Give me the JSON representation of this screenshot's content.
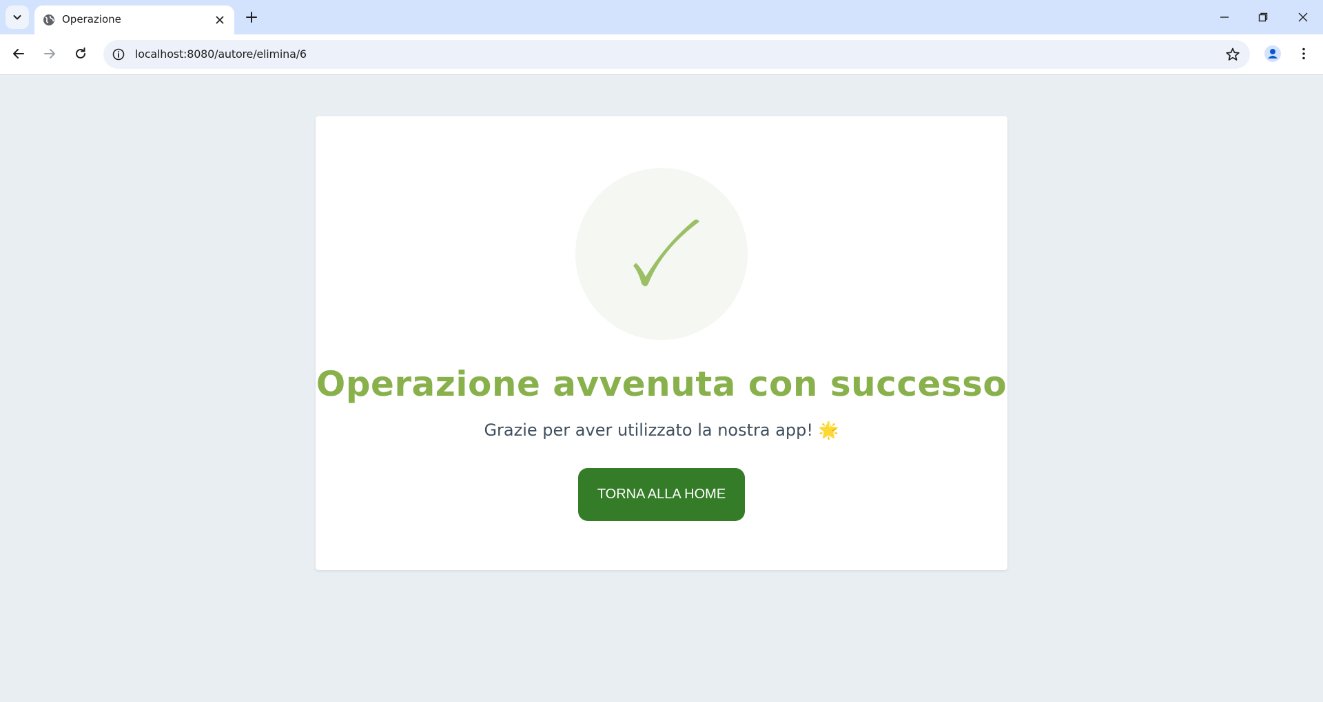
{
  "browser": {
    "tab": {
      "title": "Operazione",
      "favicon_icon": "globe-icon",
      "close_icon": "close-icon"
    },
    "new_tab_icon": "plus-icon",
    "window_controls": [
      "minimize-icon",
      "restore-icon",
      "close-icon"
    ],
    "toolbar": {
      "back_icon": "back-arrow-icon",
      "forward_icon": "forward-arrow-icon",
      "reload_icon": "reload-icon",
      "url": "localhost:8080/autore/elimina/6",
      "site_info_icon": "info-icon",
      "bookmark_icon": "star-icon",
      "profile_icon": "profile-icon",
      "menu_icon": "kebab-menu-icon"
    },
    "colors": {
      "tabstrip": "#d3e3fd",
      "omnibox": "#edf2fa"
    }
  },
  "page": {
    "title": "Operazione avvenuta con successo",
    "subtitle": "Grazie per aver utilizzato la nostra app! 🌟",
    "button_label": "TORNA ALLA HOME",
    "check_icon": "checkmark-icon",
    "colors": {
      "background": "#e9eef2",
      "title": "#88b04b",
      "button": "#357c29",
      "check": "#9abf65",
      "check_circle": "#f5f7f2"
    }
  }
}
